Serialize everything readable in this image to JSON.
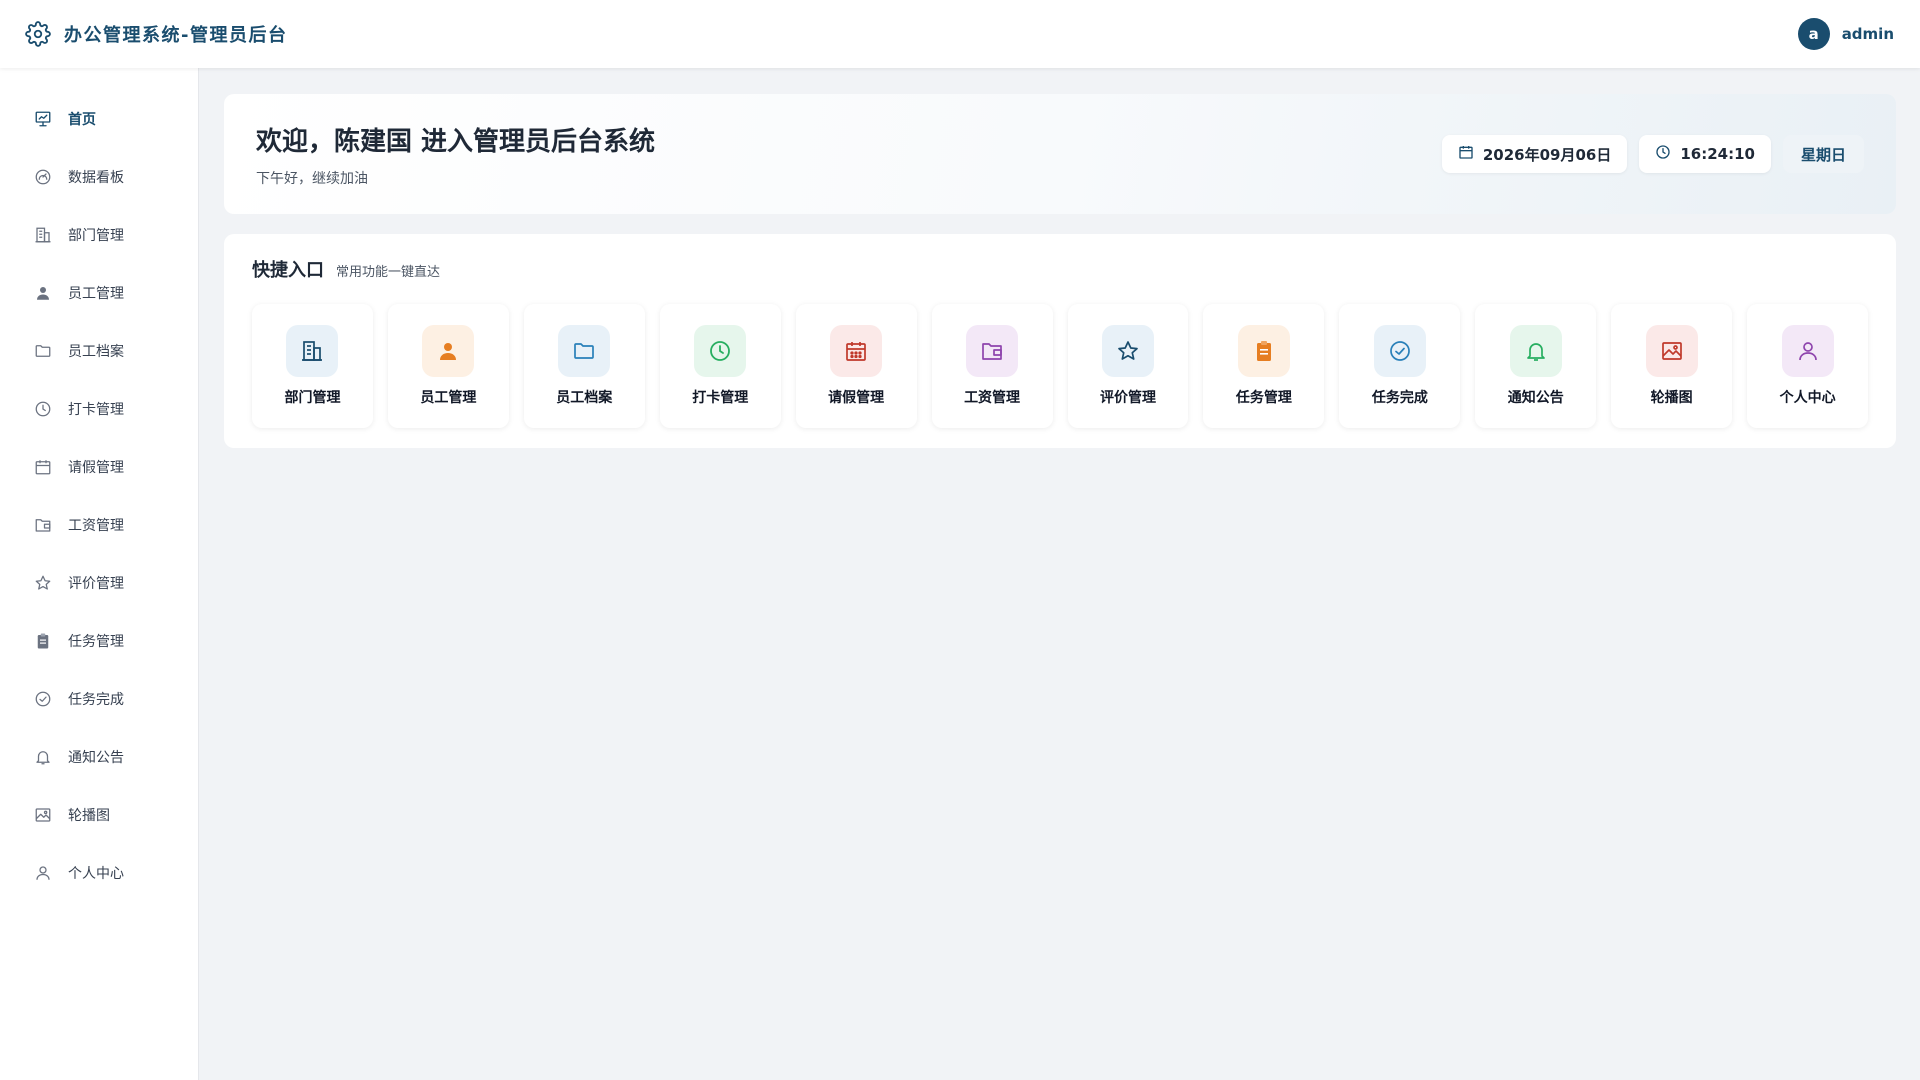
{
  "header": {
    "brand_icon": "gear-icon",
    "title": "办公管理系统-管理员后台",
    "user": {
      "avatar_letter": "a",
      "name": "admin"
    }
  },
  "colors": {
    "brand": "#1a4d6e",
    "background": "#f1f3f6"
  },
  "sidebar": {
    "items": [
      {
        "label": "首页",
        "icon": "home-chart-icon",
        "active": true
      },
      {
        "label": "数据看板",
        "icon": "dashboard-icon",
        "active": false
      },
      {
        "label": "部门管理",
        "icon": "building-icon",
        "active": false
      },
      {
        "label": "员工管理",
        "icon": "user-icon",
        "active": false
      },
      {
        "label": "员工档案",
        "icon": "folder-icon",
        "active": false
      },
      {
        "label": "打卡管理",
        "icon": "clock-icon",
        "active": false
      },
      {
        "label": "请假管理",
        "icon": "calendar-icon",
        "active": false
      },
      {
        "label": "工资管理",
        "icon": "wallet-icon",
        "active": false
      },
      {
        "label": "评价管理",
        "icon": "star-icon",
        "active": false
      },
      {
        "label": "任务管理",
        "icon": "clipboard-icon",
        "active": false
      },
      {
        "label": "任务完成",
        "icon": "check-circle-icon",
        "active": false
      },
      {
        "label": "通知公告",
        "icon": "bell-icon",
        "active": false
      },
      {
        "label": "轮播图",
        "icon": "image-icon",
        "active": false
      },
      {
        "label": "个人中心",
        "icon": "person-icon",
        "active": false
      }
    ]
  },
  "welcome": {
    "title": "欢迎，陈建国 进入管理员后台系统",
    "subtitle": "下午好，继续加油",
    "date": "2026年09月06日",
    "time": "16:24:10",
    "weekday": "星期日"
  },
  "quick": {
    "title": "快捷入口",
    "subtitle": "常用功能一键直达",
    "cards": [
      {
        "label": "部门管理",
        "icon": "building-icon",
        "color": "#1a4d6e",
        "bg": "#e8f1f8"
      },
      {
        "label": "员工管理",
        "icon": "user-icon",
        "color": "#e67e22",
        "bg": "#fdf0e3"
      },
      {
        "label": "员工档案",
        "icon": "folder-icon",
        "color": "#2980b9",
        "bg": "#e8f1f8"
      },
      {
        "label": "打卡管理",
        "icon": "clock-icon",
        "color": "#27ae60",
        "bg": "#e6f6ec"
      },
      {
        "label": "请假管理",
        "icon": "calendar-icon",
        "color": "#c0392b",
        "bg": "#fbe9e8"
      },
      {
        "label": "工资管理",
        "icon": "wallet-icon",
        "color": "#8e44ad",
        "bg": "#f3e8f7"
      },
      {
        "label": "评价管理",
        "icon": "star-icon",
        "color": "#1a4d6e",
        "bg": "#e8f1f8"
      },
      {
        "label": "任务管理",
        "icon": "clipboard-icon",
        "color": "#e67e22",
        "bg": "#fdf0e3"
      },
      {
        "label": "任务完成",
        "icon": "check-circle-icon",
        "color": "#2980b9",
        "bg": "#e8f1f8"
      },
      {
        "label": "通知公告",
        "icon": "bell-icon",
        "color": "#27ae60",
        "bg": "#e6f6ec"
      },
      {
        "label": "轮播图",
        "icon": "image-icon",
        "color": "#c0392b",
        "bg": "#fbe9e8"
      },
      {
        "label": "个人中心",
        "icon": "person-icon",
        "color": "#8e44ad",
        "bg": "#f3e8f7"
      }
    ]
  }
}
